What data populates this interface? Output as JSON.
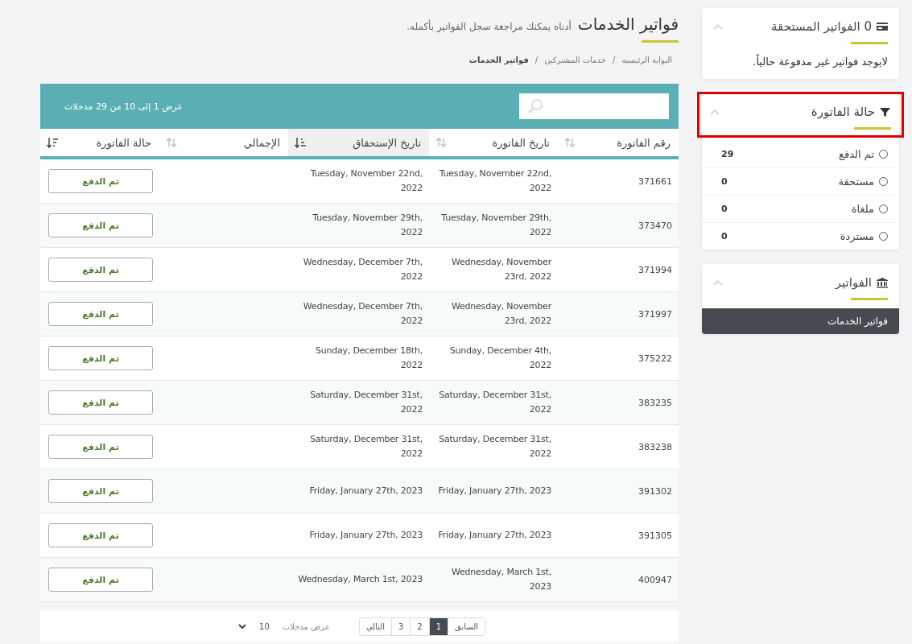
{
  "page": {
    "title": "فواتير الخدمات",
    "subtitle": "أدناه يمكنك مراجعة سجل الفواتير بأكمله.",
    "breadcrumbs": [
      {
        "label": "البوابة الرئيسية",
        "current": false,
        "separator": "/"
      },
      {
        "label": "خدمات المشتركين",
        "current": false,
        "separator": "/"
      },
      {
        "label": "فواتير الخدمات",
        "current": true
      }
    ]
  },
  "table": {
    "info": "عرض 1 إلى 10 من 29 مدخلات",
    "columns": [
      {
        "label": "رقم الفاتورة",
        "sorted": false
      },
      {
        "label": "تاريخ الفاتورة",
        "sorted": false
      },
      {
        "label": "تاريخ الإستحقاق",
        "sorted": true
      },
      {
        "label": "الإجمالي",
        "sorted": false
      },
      {
        "label": "حالة الفاتورة",
        "sorted": false
      }
    ],
    "rows": [
      {
        "number": "371661",
        "date": "Tuesday, November 22nd, 2022",
        "due": "Tuesday, November 22nd, 2022",
        "status": "تم الدفع"
      },
      {
        "number": "373470",
        "date": "Tuesday, November 29th, 2022",
        "due": "Tuesday, November 29th, 2022",
        "status": "تم الدفع"
      },
      {
        "number": "371994",
        "date": "Wednesday, November 23rd, 2022",
        "due": "Wednesday, December 7th, 2022",
        "status": "تم الدفع"
      },
      {
        "number": "371997",
        "date": "Wednesday, November 23rd, 2022",
        "due": "Wednesday, December 7th, 2022",
        "status": "تم الدفع"
      },
      {
        "number": "375222",
        "date": "Sunday, December 4th, 2022",
        "due": "Sunday, December 18th, 2022",
        "status": "تم الدفع"
      },
      {
        "number": "383235",
        "date": "Saturday, December 31st, 2022",
        "due": "Saturday, December 31st, 2022",
        "status": "تم الدفع"
      },
      {
        "number": "383238",
        "date": "Saturday, December 31st, 2022",
        "due": "Saturday, December 31st, 2022",
        "status": "تم الدفع"
      },
      {
        "number": "391302",
        "date": "Friday, January 27th, 2023",
        "due": "Friday, January 27th, 2023",
        "status": "تم الدفع"
      },
      {
        "number": "391305",
        "date": "Friday, January 27th, 2023",
        "due": "Friday, January 27th, 2023",
        "status": "تم الدفع"
      },
      {
        "number": "400947",
        "date": "Wednesday, March 1st, 2023",
        "due": "Wednesday, March 1st, 2023",
        "status": "تم الدفع"
      }
    ],
    "pagination": {
      "pages": [
        {
          "label": "السابق",
          "selected": false
        },
        {
          "label": "1",
          "selected": true
        },
        {
          "label": "2",
          "selected": false
        },
        {
          "label": "3",
          "selected": false
        },
        {
          "label": "التالي",
          "selected": false
        }
      ],
      "length_label": "عرض مدخلات",
      "length_value": "10"
    }
  },
  "sidebar": {
    "panels": [
      {
        "kind": "text",
        "title": "0 الفواتير المستحقة",
        "highlighted": false,
        "text": "لايوجد فواتير غير مدفوعة حالياً."
      },
      {
        "kind": "filter",
        "title": "حالة الفاتورة",
        "highlighted": true,
        "options": [
          {
            "label": "تم الدفع",
            "count": "29",
            "selected": false
          },
          {
            "label": "مستحقة",
            "count": "0",
            "selected": false
          },
          {
            "label": "ملغاة",
            "count": "0",
            "selected": false
          },
          {
            "label": "مستردة",
            "count": "0",
            "selected": false
          }
        ]
      },
      {
        "kind": "menu",
        "title": "الفواتير",
        "highlighted": false,
        "items": [
          {
            "label": "فواتير الخدمات",
            "selected": true
          }
        ]
      }
    ]
  }
}
